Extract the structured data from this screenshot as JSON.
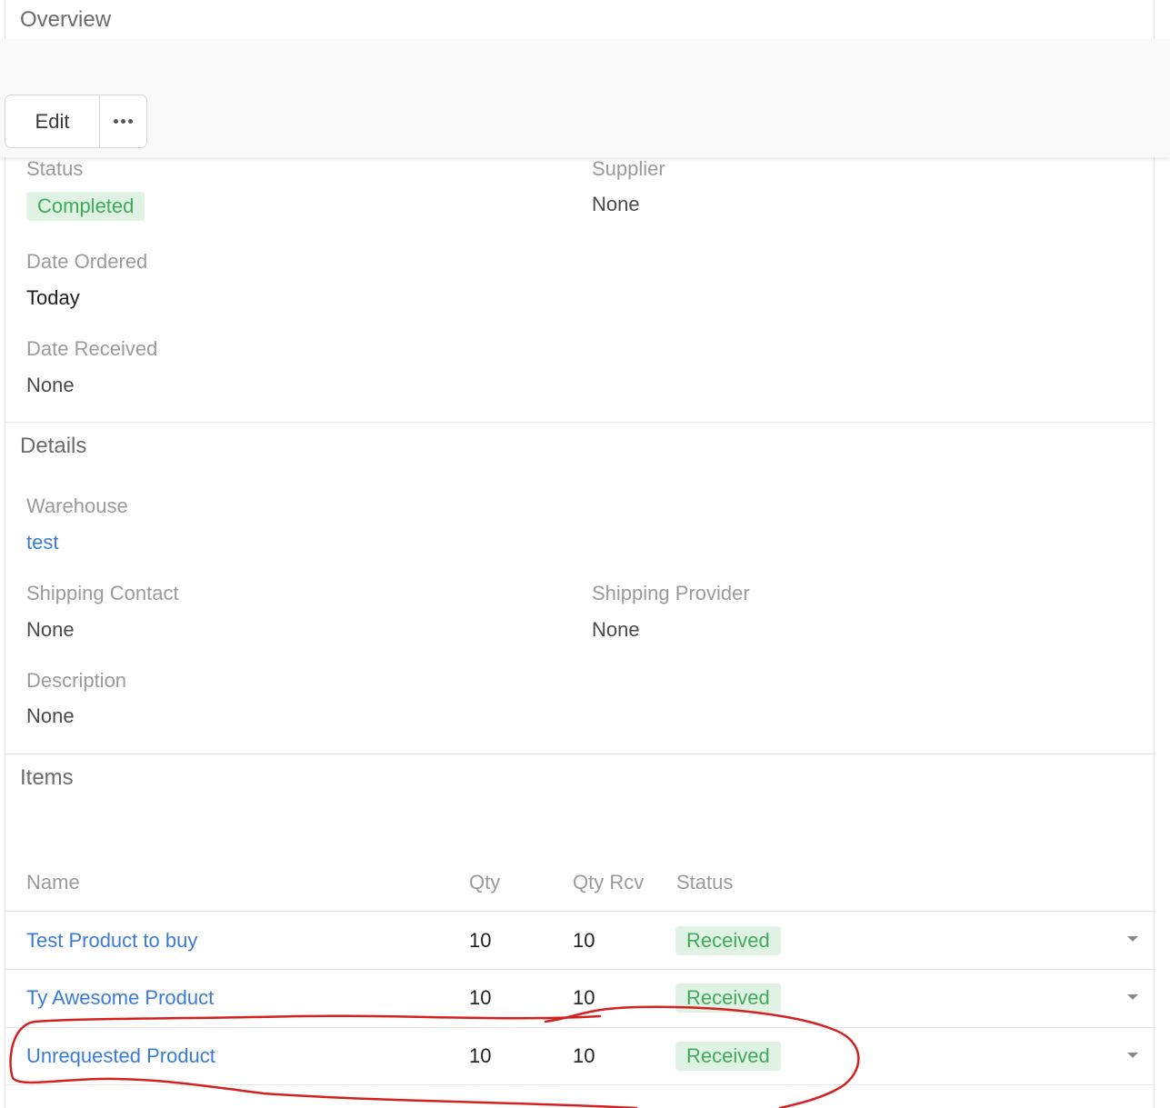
{
  "overview": {
    "title": "Overview",
    "status_label": "Status",
    "status_value": "Completed",
    "supplier_label": "Supplier",
    "supplier_value": "None",
    "date_ordered_label": "Date Ordered",
    "date_ordered_value": "Today",
    "date_received_label": "Date Received",
    "date_received_value": "None"
  },
  "toolbar": {
    "edit_label": "Edit",
    "more_icon": "more-horizontal-icon"
  },
  "details": {
    "title": "Details",
    "warehouse_label": "Warehouse",
    "warehouse_value": "test",
    "shipping_contact_label": "Shipping Contact",
    "shipping_contact_value": "None",
    "shipping_provider_label": "Shipping Provider",
    "shipping_provider_value": "None",
    "description_label": "Description",
    "description_value": "None"
  },
  "items": {
    "title": "Items",
    "columns": [
      "Name",
      "Qty",
      "Qty Rcv",
      "Status"
    ],
    "rows": [
      {
        "name": "Test Product to buy",
        "qty": "10",
        "qty_rcv": "10",
        "status": "Received"
      },
      {
        "name": "Ty Awesome Product",
        "qty": "10",
        "qty_rcv": "10",
        "status": "Received"
      },
      {
        "name": "Unrequested Product",
        "qty": "10",
        "qty_rcv": "10",
        "status": "Received"
      }
    ]
  },
  "colors": {
    "link": "#3a7bd5",
    "badge_bg": "#dff2e4",
    "badge_text": "#3faa5a",
    "annotation": "#d42020"
  }
}
